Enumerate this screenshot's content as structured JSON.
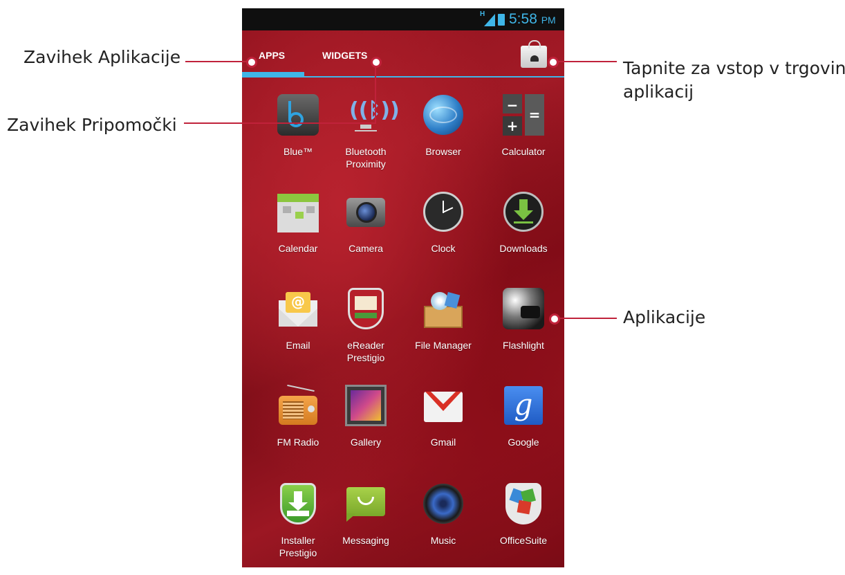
{
  "status_bar": {
    "network": "H",
    "time": "5:58",
    "ampm": "PM"
  },
  "tabs": {
    "apps": "APPS",
    "widgets": "WIDGETS"
  },
  "store_icon": "play-store-bag-icon",
  "apps": [
    {
      "label": "Blue™",
      "icon": "blue-icon"
    },
    {
      "label": "Bluetooth\nProximity",
      "icon": "bluetooth-proximity-icon"
    },
    {
      "label": "Browser",
      "icon": "globe-icon"
    },
    {
      "label": "Calculator",
      "icon": "calculator-icon"
    },
    {
      "label": "Calendar",
      "icon": "calendar-icon"
    },
    {
      "label": "Camera",
      "icon": "camera-icon"
    },
    {
      "label": "Clock",
      "icon": "clock-icon"
    },
    {
      "label": "Downloads",
      "icon": "download-icon"
    },
    {
      "label": "Email",
      "icon": "email-icon"
    },
    {
      "label": "eReader\nPrestigio",
      "icon": "ereader-icon"
    },
    {
      "label": "File Manager",
      "icon": "file-manager-icon"
    },
    {
      "label": "Flashlight",
      "icon": "flashlight-icon"
    },
    {
      "label": "FM Radio",
      "icon": "radio-icon"
    },
    {
      "label": "Gallery",
      "icon": "gallery-icon"
    },
    {
      "label": "Gmail",
      "icon": "gmail-icon"
    },
    {
      "label": "Google",
      "icon": "google-icon"
    },
    {
      "label": "Installer\nPrestigio",
      "icon": "installer-icon"
    },
    {
      "label": "Messaging",
      "icon": "messaging-icon"
    },
    {
      "label": "Music",
      "icon": "music-icon"
    },
    {
      "label": "OfficeSuite",
      "icon": "officesuite-icon"
    }
  ],
  "callouts": {
    "apps_tab": "Zavihek Aplikacije",
    "widgets_tab": "Zavihek Pripomočki",
    "store_line1": "Tapnite za vstop v trgovino",
    "store_line2": "aplikacij",
    "applications": "Aplikacije"
  },
  "colors": {
    "accent": "#3fb6e8",
    "callout_line": "#c0223a",
    "background": "#9c1723"
  }
}
